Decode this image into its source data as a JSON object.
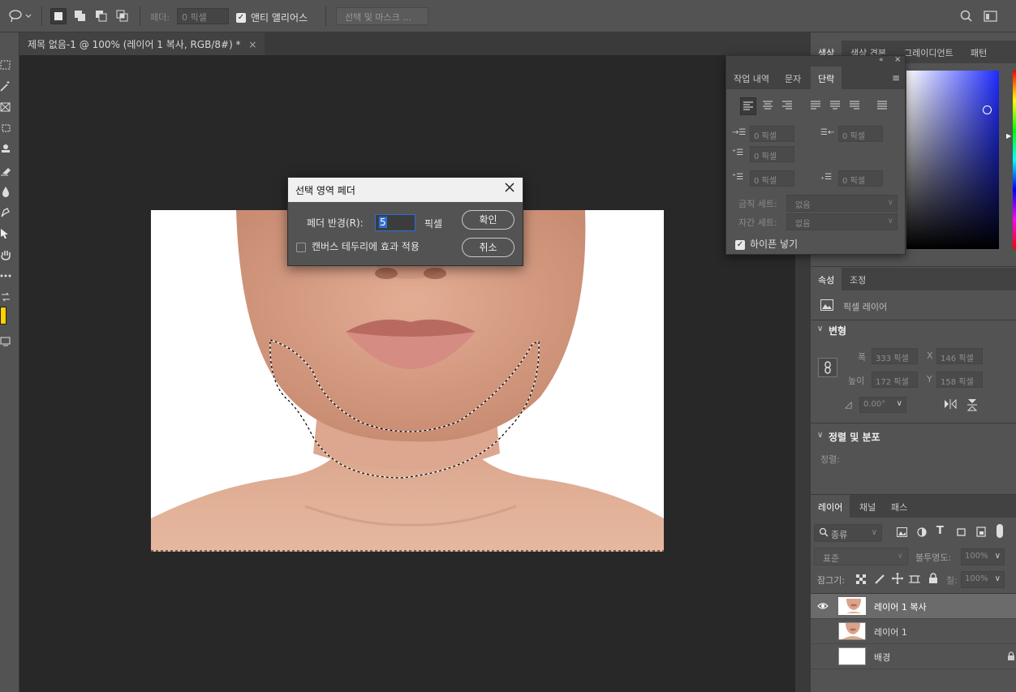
{
  "options_bar": {
    "feather_label": "페더:",
    "feather_placeholder": "0 픽셀",
    "antialias_label": "앤티 앨리어스",
    "select_mask_label": "선택 및 마스크 ..."
  },
  "document_tab": {
    "title": "제목 없음-1 @ 100% (레이어 1 복사, RGB/8#) *",
    "close": "×"
  },
  "dialog": {
    "title": "선택 영역 페더",
    "radius_label": "페더 반경(R):",
    "radius_value": "5",
    "unit": "픽셀",
    "canvas_edge_label": "캔버스 테두리에 효과 적용",
    "ok": "확인",
    "cancel": "취소"
  },
  "color_panel": {
    "tabs": [
      "색상",
      "색상 견본",
      "그레이디언트",
      "패턴"
    ]
  },
  "paragraph_panel": {
    "tabs": [
      "작업 내역",
      "문자",
      "단락"
    ],
    "field_placeholder": "0 픽셀",
    "kinsoku_label": "금칙 세트:",
    "mojikumi_label": "자간 세트:",
    "none_option": "없음",
    "hyphenate_label": "하이픈 넣기"
  },
  "properties_panel": {
    "tabs": [
      "속성",
      "조정"
    ],
    "layer_kind": "픽셀 레이어",
    "transform_title": "변형",
    "width_label": "폭",
    "width_value": "333 픽셀",
    "x_label": "X",
    "x_value": "146 픽셀",
    "height_label": "높이",
    "height_value": "172 픽셀",
    "y_label": "Y",
    "y_value": "158 픽셀",
    "angle_value": "0.00°",
    "align_title": "정렬 및 분포",
    "align_label": "정렬:"
  },
  "layers_panel": {
    "tabs": [
      "레이어",
      "채널",
      "패스"
    ],
    "filter_label": "종류",
    "blend_mode": "표준",
    "opacity_label": "불투명도:",
    "opacity_value": "100%",
    "lock_label": "잠그기:",
    "fill_label": "칠:",
    "fill_value": "100%",
    "layers": [
      {
        "name": "레이어 1 복사",
        "visible": true,
        "selected": true
      },
      {
        "name": "레이어 1",
        "visible": false,
        "selected": false
      },
      {
        "name": "배경",
        "visible": false,
        "selected": false,
        "locked": true
      }
    ]
  },
  "colors": {
    "foreground": "#ffd200",
    "picker_hue": "#1f2cff"
  }
}
